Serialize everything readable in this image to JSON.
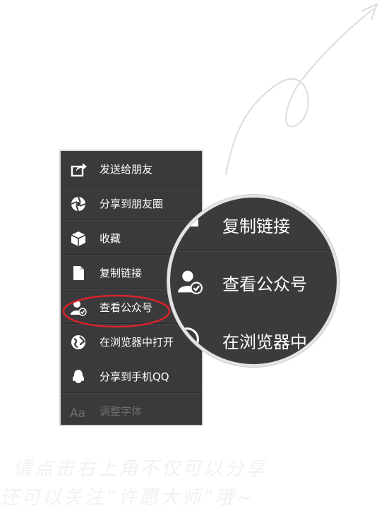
{
  "menu": {
    "items": [
      {
        "label": "发送给朋友",
        "icon": "share-out-icon"
      },
      {
        "label": "分享到朋友圈",
        "icon": "aperture-icon"
      },
      {
        "label": "收藏",
        "icon": "cube-icon"
      },
      {
        "label": "复制链接",
        "icon": "document-icon"
      },
      {
        "label": "查看公众号",
        "icon": "user-check-icon"
      },
      {
        "label": "在浏览器中打开",
        "icon": "globe-icon"
      },
      {
        "label": "分享到手机QQ",
        "icon": "qq-penguin-icon"
      },
      {
        "label": "调整字体",
        "icon": "font-aa-icon"
      }
    ]
  },
  "zoom": {
    "rows": [
      {
        "label": "复制链接"
      },
      {
        "label": "查看公众号"
      },
      {
        "label": "在浏览器中"
      }
    ]
  },
  "caption": {
    "line1": "请点击右上角不仅可以分享",
    "line2": "还可以关注“许愿大师”哦~"
  },
  "colors": {
    "menu_bg": "#3a3a3c",
    "highlight": "#d8232a",
    "caption": "#f1f1f1"
  }
}
